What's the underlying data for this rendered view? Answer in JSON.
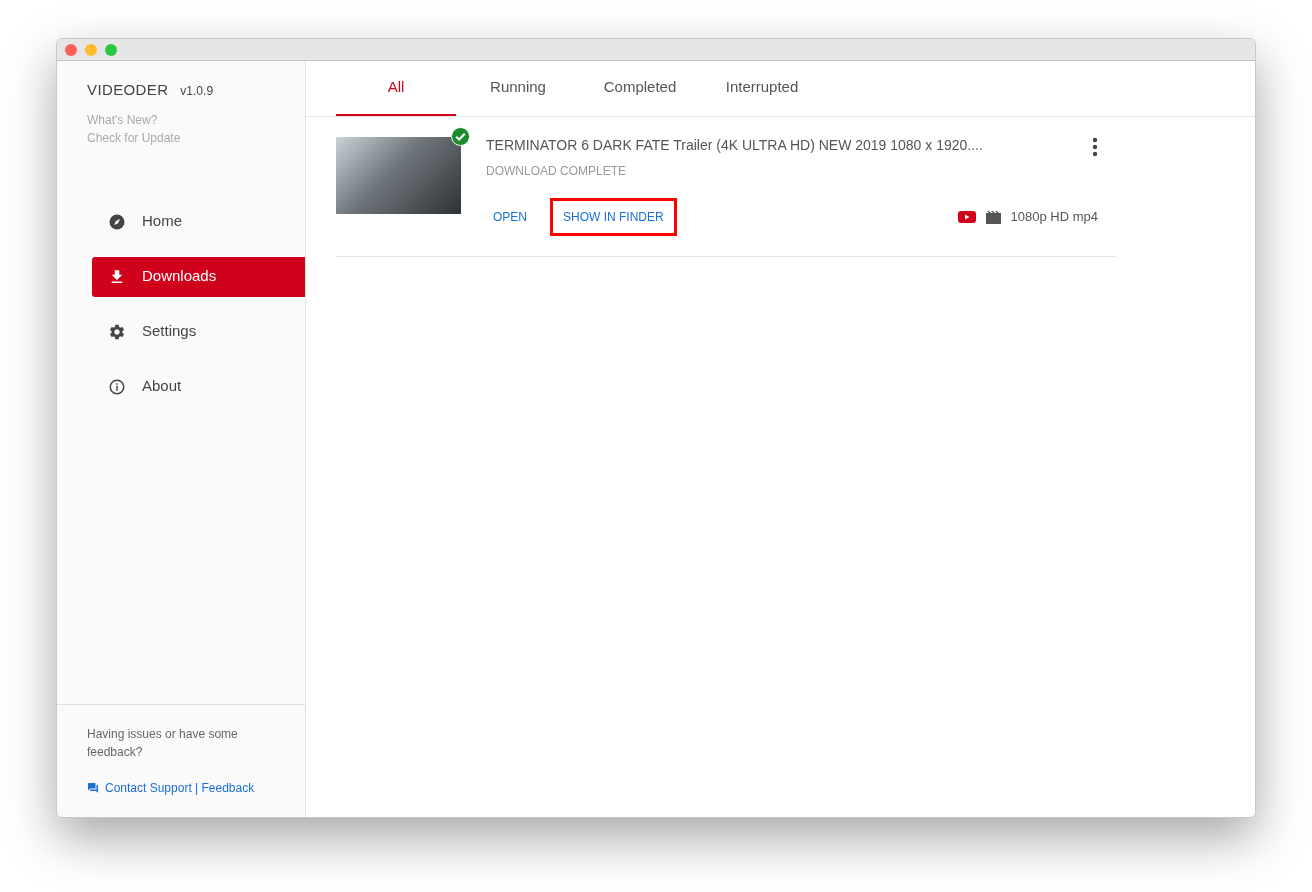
{
  "app": {
    "name": "VIDEODER",
    "version": "v1.0.9",
    "links": [
      "What's New?",
      "Check for Update"
    ]
  },
  "nav": [
    {
      "label": "Home",
      "kind": "home",
      "selected": false
    },
    {
      "label": "Downloads",
      "kind": "downloads",
      "selected": true
    },
    {
      "label": "Settings",
      "kind": "settings",
      "selected": false
    },
    {
      "label": "About",
      "kind": "about",
      "selected": false
    }
  ],
  "footer": {
    "text": "Having issues or have some feedback?",
    "link": "Contact Support | Feedback"
  },
  "tabs": [
    {
      "label": "All",
      "selected": true
    },
    {
      "label": "Running",
      "selected": false
    },
    {
      "label": "Completed",
      "selected": false
    },
    {
      "label": "Interrupted",
      "selected": false
    }
  ],
  "downloads": [
    {
      "title": "TERMINATOR 6 DARK FATE Trailer (4K ULTRA HD) NEW 2019 1080 x 1920....",
      "status": "DOWNLOAD COMPLETE",
      "completed": true,
      "actions": [
        {
          "label": "OPEN",
          "highlighted": false
        },
        {
          "label": "SHOW IN FINDER",
          "highlighted": true
        }
      ],
      "format": "1080p HD mp4"
    }
  ]
}
